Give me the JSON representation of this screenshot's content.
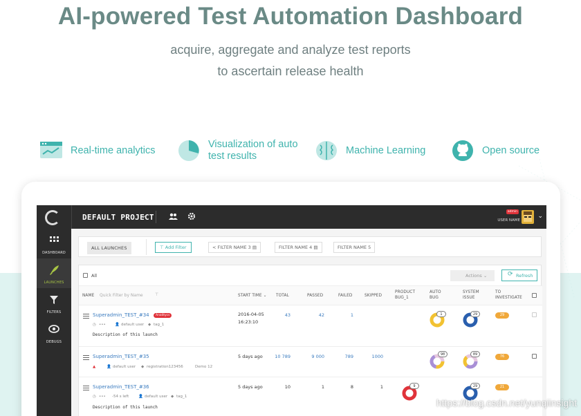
{
  "hero": {
    "title": "AI-powered Test Automation Dashboard",
    "subtitle_line1": "acquire, aggregate and analyze test reports",
    "subtitle_line2": "to ascertain release health"
  },
  "features": [
    {
      "icon": "analytics-window-icon",
      "label": "Real-time analytics"
    },
    {
      "icon": "pie-chart-icon",
      "label_line1": "Visualization of auto",
      "label_line2": "test results"
    },
    {
      "icon": "brain-icon",
      "label": "Machine Learning"
    },
    {
      "icon": "github-icon",
      "label": "Open source"
    }
  ],
  "topbar": {
    "project": "DEFAULT PROJECT",
    "admin_badge": "admin",
    "user_name": "USER NAME"
  },
  "sidebar": [
    {
      "icon": "grid-icon",
      "label": "DASHBOARD"
    },
    {
      "icon": "rocket-icon",
      "label": "LAUNCHES"
    },
    {
      "icon": "funnel-icon",
      "label": "FILTERS"
    },
    {
      "icon": "eye-icon",
      "label": "DEBUGS"
    }
  ],
  "filterbar": {
    "all_launches": "ALL LAUNCHES",
    "add_filter": "Add Filter",
    "chips": [
      "FILTER NAME 3",
      "FILTER NAME 4",
      "FILTER NAME 5"
    ]
  },
  "toolbar": {
    "all": "All",
    "actions": "Actions",
    "refresh": "Refresh"
  },
  "columns": {
    "name": "NAME",
    "quick_filter": "Quick Filter by Name",
    "start_time": "START TIME",
    "total": "TOTAL",
    "passed": "PASSED",
    "failed": "FAILED",
    "skipped": "SKIPPED",
    "product_bug_l1": "PRODUCT",
    "product_bug_l2": "BUG_1",
    "auto_bug_l1": "AUTO",
    "auto_bug_l2": "BUG",
    "system_issue_l1": "SYSTEM",
    "system_issue_l2": "ISSUE",
    "to_investigate_l1": "TO",
    "to_investigate_l2": "INVESTIGATE"
  },
  "launches": [
    {
      "name": "Superadmin_TEST_#34",
      "tag": "Analitycs",
      "dots": "•••",
      "owner": "default user",
      "attr": "tag_1",
      "description": "Description of this launch",
      "start_date": "2016-04-05",
      "start_time": "16:23:10",
      "total": "43",
      "passed": "42",
      "failed": "1",
      "skipped": "",
      "product_bug": "",
      "auto_bug": "1",
      "system_issue": "29",
      "to_investigate": "29"
    },
    {
      "name": "Superadmin_TEST_#35",
      "owner": "default user",
      "attr": "registration123456",
      "attr2": "Demo 12",
      "start": "5 days ago",
      "total": "10 789",
      "passed": "9 000",
      "failed": "789",
      "skipped": "1000",
      "auto_bug": "98",
      "system_issue": "89",
      "to_investigate": "76"
    },
    {
      "name": "Superadmin_TEST_#36",
      "dots": "•••",
      "left": "-54 s left",
      "owner": "default user",
      "attr": "tag_1",
      "description": "Description of this launch",
      "start": "5 days ago",
      "total": "10",
      "passed": "1",
      "failed": "8",
      "skipped": "1",
      "product_bug": "9",
      "system_issue": "29",
      "to_investigate": "21"
    }
  ],
  "watermark": "https://blog.csdn.net/yunqiinsight",
  "colors": {
    "accent": "#3fb3ad",
    "title": "#6a8a86",
    "topbar": "#2c2c2c",
    "to_investigate": "#f0a83a",
    "system_issue": "#2a5fae",
    "auto_bug": "#f2c232",
    "product_bug": "#e0333a",
    "link": "#3a7bbf"
  }
}
